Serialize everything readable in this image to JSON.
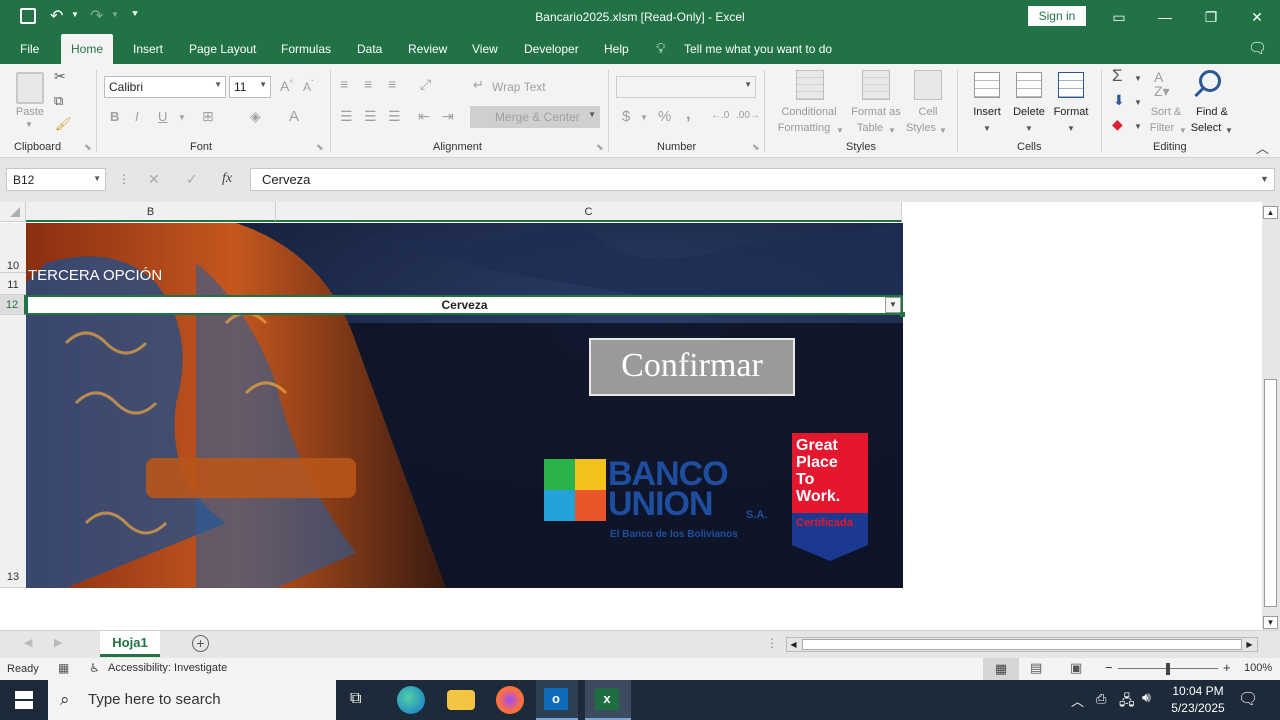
{
  "window": {
    "title": "Bancario2025.xlsm  [Read-Only]  -  Excel",
    "sign_in": "Sign in"
  },
  "menu": {
    "tabs": [
      "File",
      "Home",
      "Insert",
      "Page Layout",
      "Formulas",
      "Data",
      "Review",
      "View",
      "Developer",
      "Help"
    ],
    "active": "Home",
    "tell_me": "Tell me what you want to do"
  },
  "ribbon": {
    "clipboard": {
      "label": "Clipboard",
      "paste": "Paste"
    },
    "font": {
      "label": "Font",
      "name": "Calibri",
      "size": "11",
      "bold": "B",
      "italic": "I",
      "underline": "U"
    },
    "alignment": {
      "label": "Alignment",
      "wrap": "Wrap Text",
      "merge": "Merge & Center"
    },
    "number": {
      "label": "Number",
      "currency": "$",
      "percent": "%",
      "comma": ","
    },
    "styles": {
      "label": "Styles",
      "conditional": "Conditional",
      "conditional2": "Formatting",
      "format_table": "Format as",
      "format_table2": "Table",
      "cell_styles": "Cell",
      "cell_styles2": "Styles"
    },
    "cells": {
      "label": "Cells",
      "insert": "Insert",
      "delete": "Delete",
      "format": "Format"
    },
    "editing": {
      "label": "Editing",
      "sort": "Sort &",
      "sort2": "Filter",
      "find": "Find &",
      "find2": "Select"
    }
  },
  "formula_bar": {
    "name_box": "B12",
    "fx": "fx",
    "content": "Cerveza"
  },
  "grid": {
    "columns": [
      "B",
      "C"
    ],
    "rows": [
      "10",
      "11",
      "12",
      "13"
    ],
    "cell_b11": "TERCERA OPCIÓN",
    "cell_b12": "Cerveza",
    "button": "Confirmar",
    "bank_logo": {
      "name": "BANCO",
      "name2": "UNION",
      "suffix": "S.A.",
      "tagline": "El Banco de los Bolivianos"
    },
    "gptw": {
      "line1": "Great",
      "line2": "Place",
      "line3": "To",
      "line4": "Work.",
      "cert": "Certificada"
    }
  },
  "sheets": {
    "tabs": [
      "Hoja1"
    ],
    "active": "Hoja1"
  },
  "status": {
    "ready": "Ready",
    "accessibility": "Accessibility: Investigate",
    "zoom": "100%"
  },
  "taskbar": {
    "search": "Type here to search",
    "time": "10:04 PM",
    "date": "5/23/2025"
  },
  "colors": {
    "excel_green": "#217346",
    "banner_bg": "#121a30",
    "gptw_red": "#e4172f",
    "gptw_blue": "#1b3a8f",
    "bank_blue": "#1f4da0"
  }
}
